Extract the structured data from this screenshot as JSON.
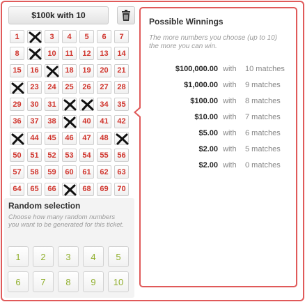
{
  "ticket": {
    "select_label": "$100k with 10",
    "trash_icon": "trash-icon"
  },
  "numbers": [
    {
      "n": "1",
      "picked": false
    },
    {
      "n": "2",
      "picked": true
    },
    {
      "n": "3",
      "picked": false
    },
    {
      "n": "4",
      "picked": false
    },
    {
      "n": "5",
      "picked": false
    },
    {
      "n": "6",
      "picked": false
    },
    {
      "n": "7",
      "picked": false
    },
    {
      "n": "8",
      "picked": false
    },
    {
      "n": "9",
      "picked": true
    },
    {
      "n": "10",
      "picked": false
    },
    {
      "n": "11",
      "picked": false
    },
    {
      "n": "12",
      "picked": false
    },
    {
      "n": "13",
      "picked": false
    },
    {
      "n": "14",
      "picked": false
    },
    {
      "n": "15",
      "picked": false
    },
    {
      "n": "16",
      "picked": false
    },
    {
      "n": "17",
      "picked": true
    },
    {
      "n": "18",
      "picked": false
    },
    {
      "n": "19",
      "picked": false
    },
    {
      "n": "20",
      "picked": false
    },
    {
      "n": "21",
      "picked": false
    },
    {
      "n": "22",
      "picked": true
    },
    {
      "n": "23",
      "picked": false
    },
    {
      "n": "24",
      "picked": false
    },
    {
      "n": "25",
      "picked": false
    },
    {
      "n": "26",
      "picked": false
    },
    {
      "n": "27",
      "picked": false
    },
    {
      "n": "28",
      "picked": false
    },
    {
      "n": "29",
      "picked": false
    },
    {
      "n": "30",
      "picked": false
    },
    {
      "n": "31",
      "picked": false
    },
    {
      "n": "32",
      "picked": true
    },
    {
      "n": "33",
      "picked": true
    },
    {
      "n": "34",
      "picked": false
    },
    {
      "n": "35",
      "picked": false
    },
    {
      "n": "36",
      "picked": false
    },
    {
      "n": "37",
      "picked": false
    },
    {
      "n": "38",
      "picked": false
    },
    {
      "n": "39",
      "picked": true
    },
    {
      "n": "40",
      "picked": false
    },
    {
      "n": "41",
      "picked": false
    },
    {
      "n": "42",
      "picked": false
    },
    {
      "n": "43",
      "picked": true
    },
    {
      "n": "44",
      "picked": false
    },
    {
      "n": "45",
      "picked": false
    },
    {
      "n": "46",
      "picked": false
    },
    {
      "n": "47",
      "picked": false
    },
    {
      "n": "48",
      "picked": false
    },
    {
      "n": "49",
      "picked": true
    },
    {
      "n": "50",
      "picked": false
    },
    {
      "n": "51",
      "picked": false
    },
    {
      "n": "52",
      "picked": false
    },
    {
      "n": "53",
      "picked": false
    },
    {
      "n": "54",
      "picked": false
    },
    {
      "n": "55",
      "picked": false
    },
    {
      "n": "56",
      "picked": false
    },
    {
      "n": "57",
      "picked": false
    },
    {
      "n": "58",
      "picked": false
    },
    {
      "n": "59",
      "picked": false
    },
    {
      "n": "60",
      "picked": false
    },
    {
      "n": "61",
      "picked": false
    },
    {
      "n": "62",
      "picked": false
    },
    {
      "n": "63",
      "picked": false
    },
    {
      "n": "64",
      "picked": false
    },
    {
      "n": "65",
      "picked": false
    },
    {
      "n": "66",
      "picked": false
    },
    {
      "n": "67",
      "picked": true
    },
    {
      "n": "68",
      "picked": false
    },
    {
      "n": "69",
      "picked": false
    },
    {
      "n": "70",
      "picked": false
    }
  ],
  "random": {
    "title": "Random selection",
    "description": "Choose how many random numbers you want to be generated for this ticket.",
    "options": [
      "1",
      "2",
      "3",
      "4",
      "5",
      "6",
      "7",
      "8",
      "9",
      "10"
    ]
  },
  "winnings": {
    "title": "Possible Winnings",
    "subtitle": "The more numbers you choose (up to 10) the more you can win.",
    "rows": [
      {
        "amount": "$100,000.00",
        "with": "with",
        "matches": "10 matches"
      },
      {
        "amount": "$1,000.00",
        "with": "with",
        "matches": "9 matches"
      },
      {
        "amount": "$100.00",
        "with": "with",
        "matches": "8 matches"
      },
      {
        "amount": "$10.00",
        "with": "with",
        "matches": "7 matches"
      },
      {
        "amount": "$5.00",
        "with": "with",
        "matches": "6 matches"
      },
      {
        "amount": "$2.00",
        "with": "with",
        "matches": "5 matches"
      },
      {
        "amount": "$2.00",
        "with": "with",
        "matches": "0 matches"
      }
    ]
  },
  "colors": {
    "accent": "#e05a5a",
    "number_text": "#d0342c",
    "random_text": "#8fae2a"
  }
}
